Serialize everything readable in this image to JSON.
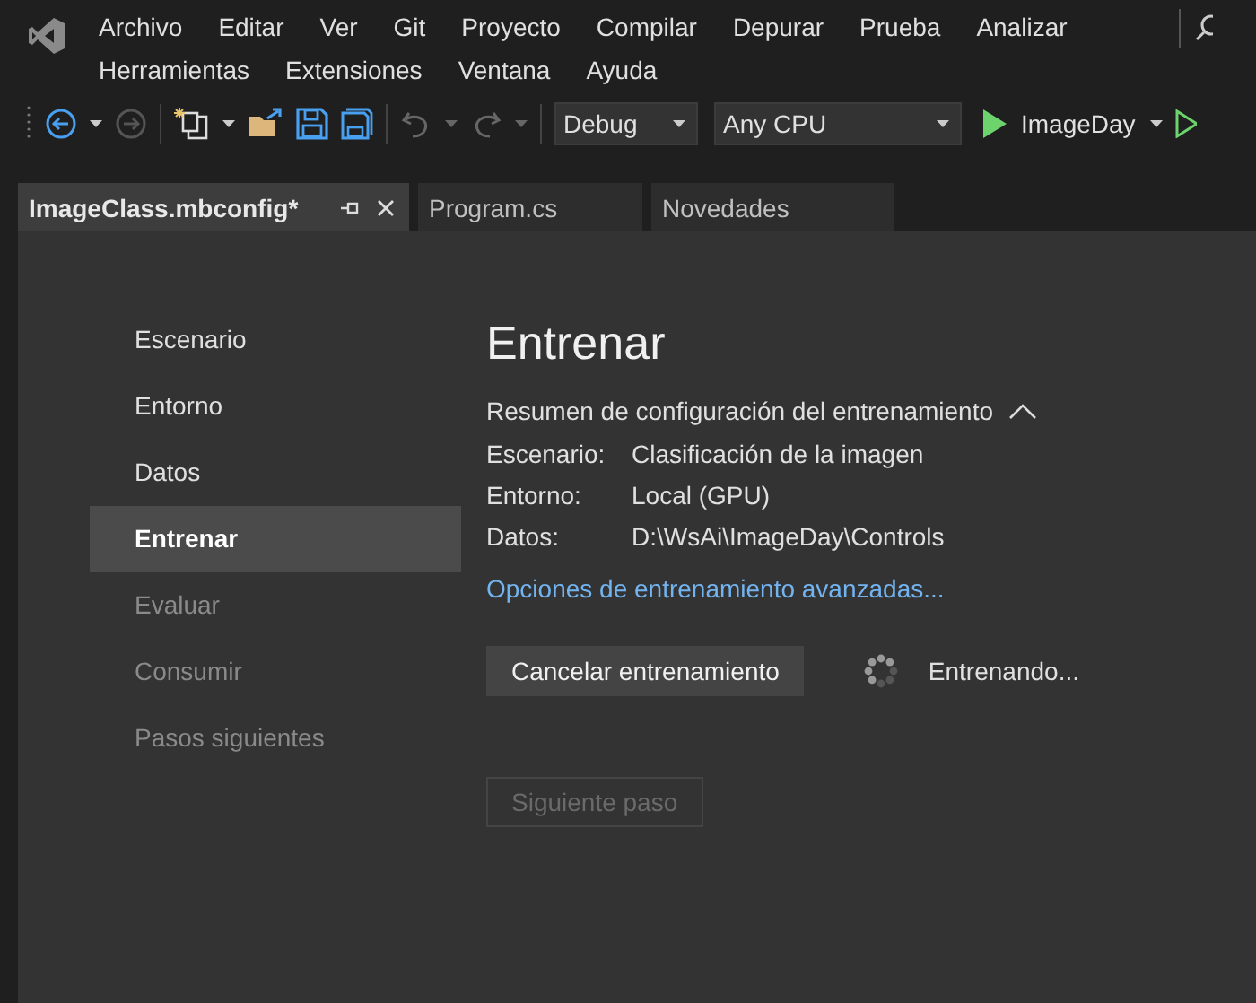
{
  "menu": {
    "items": [
      "Archivo",
      "Editar",
      "Ver",
      "Git",
      "Proyecto",
      "Compilar",
      "Depurar",
      "Prueba",
      "Analizar",
      "Herramientas",
      "Extensiones",
      "Ventana",
      "Ayuda"
    ]
  },
  "toolbar": {
    "configuration": "Debug",
    "platform": "Any CPU",
    "startup_project": "ImageDay"
  },
  "tabs": [
    {
      "label": "ImageClass.mbconfig*",
      "selected": true
    },
    {
      "label": "Program.cs",
      "selected": false
    },
    {
      "label": "Novedades",
      "selected": false
    }
  ],
  "sidebar": {
    "items": [
      {
        "label": "Escenario",
        "selected": false,
        "disabled": false
      },
      {
        "label": "Entorno",
        "selected": false,
        "disabled": false
      },
      {
        "label": "Datos",
        "selected": false,
        "disabled": false
      },
      {
        "label": "Entrenar",
        "selected": true,
        "disabled": false
      },
      {
        "label": "Evaluar",
        "selected": false,
        "disabled": true
      },
      {
        "label": "Consumir",
        "selected": false,
        "disabled": true
      },
      {
        "label": "Pasos siguientes",
        "selected": false,
        "disabled": true
      }
    ]
  },
  "main": {
    "title": "Entrenar",
    "summary": {
      "heading": "Resumen de configuración del entrenamiento",
      "expanded": true,
      "rows": [
        {
          "label": "Escenario:",
          "value": "Clasificación de la imagen"
        },
        {
          "label": "Entorno:",
          "value": "Local (GPU)"
        },
        {
          "label": "Datos:",
          "value": "D:\\WsAi\\ImageDay\\Controls"
        }
      ]
    },
    "advanced_link": "Opciones de entrenamiento avanzadas...",
    "cancel_button": "Cancelar entrenamiento",
    "status": "Entrenando...",
    "next_button": {
      "label": "Siguiente paso",
      "disabled": true
    }
  }
}
